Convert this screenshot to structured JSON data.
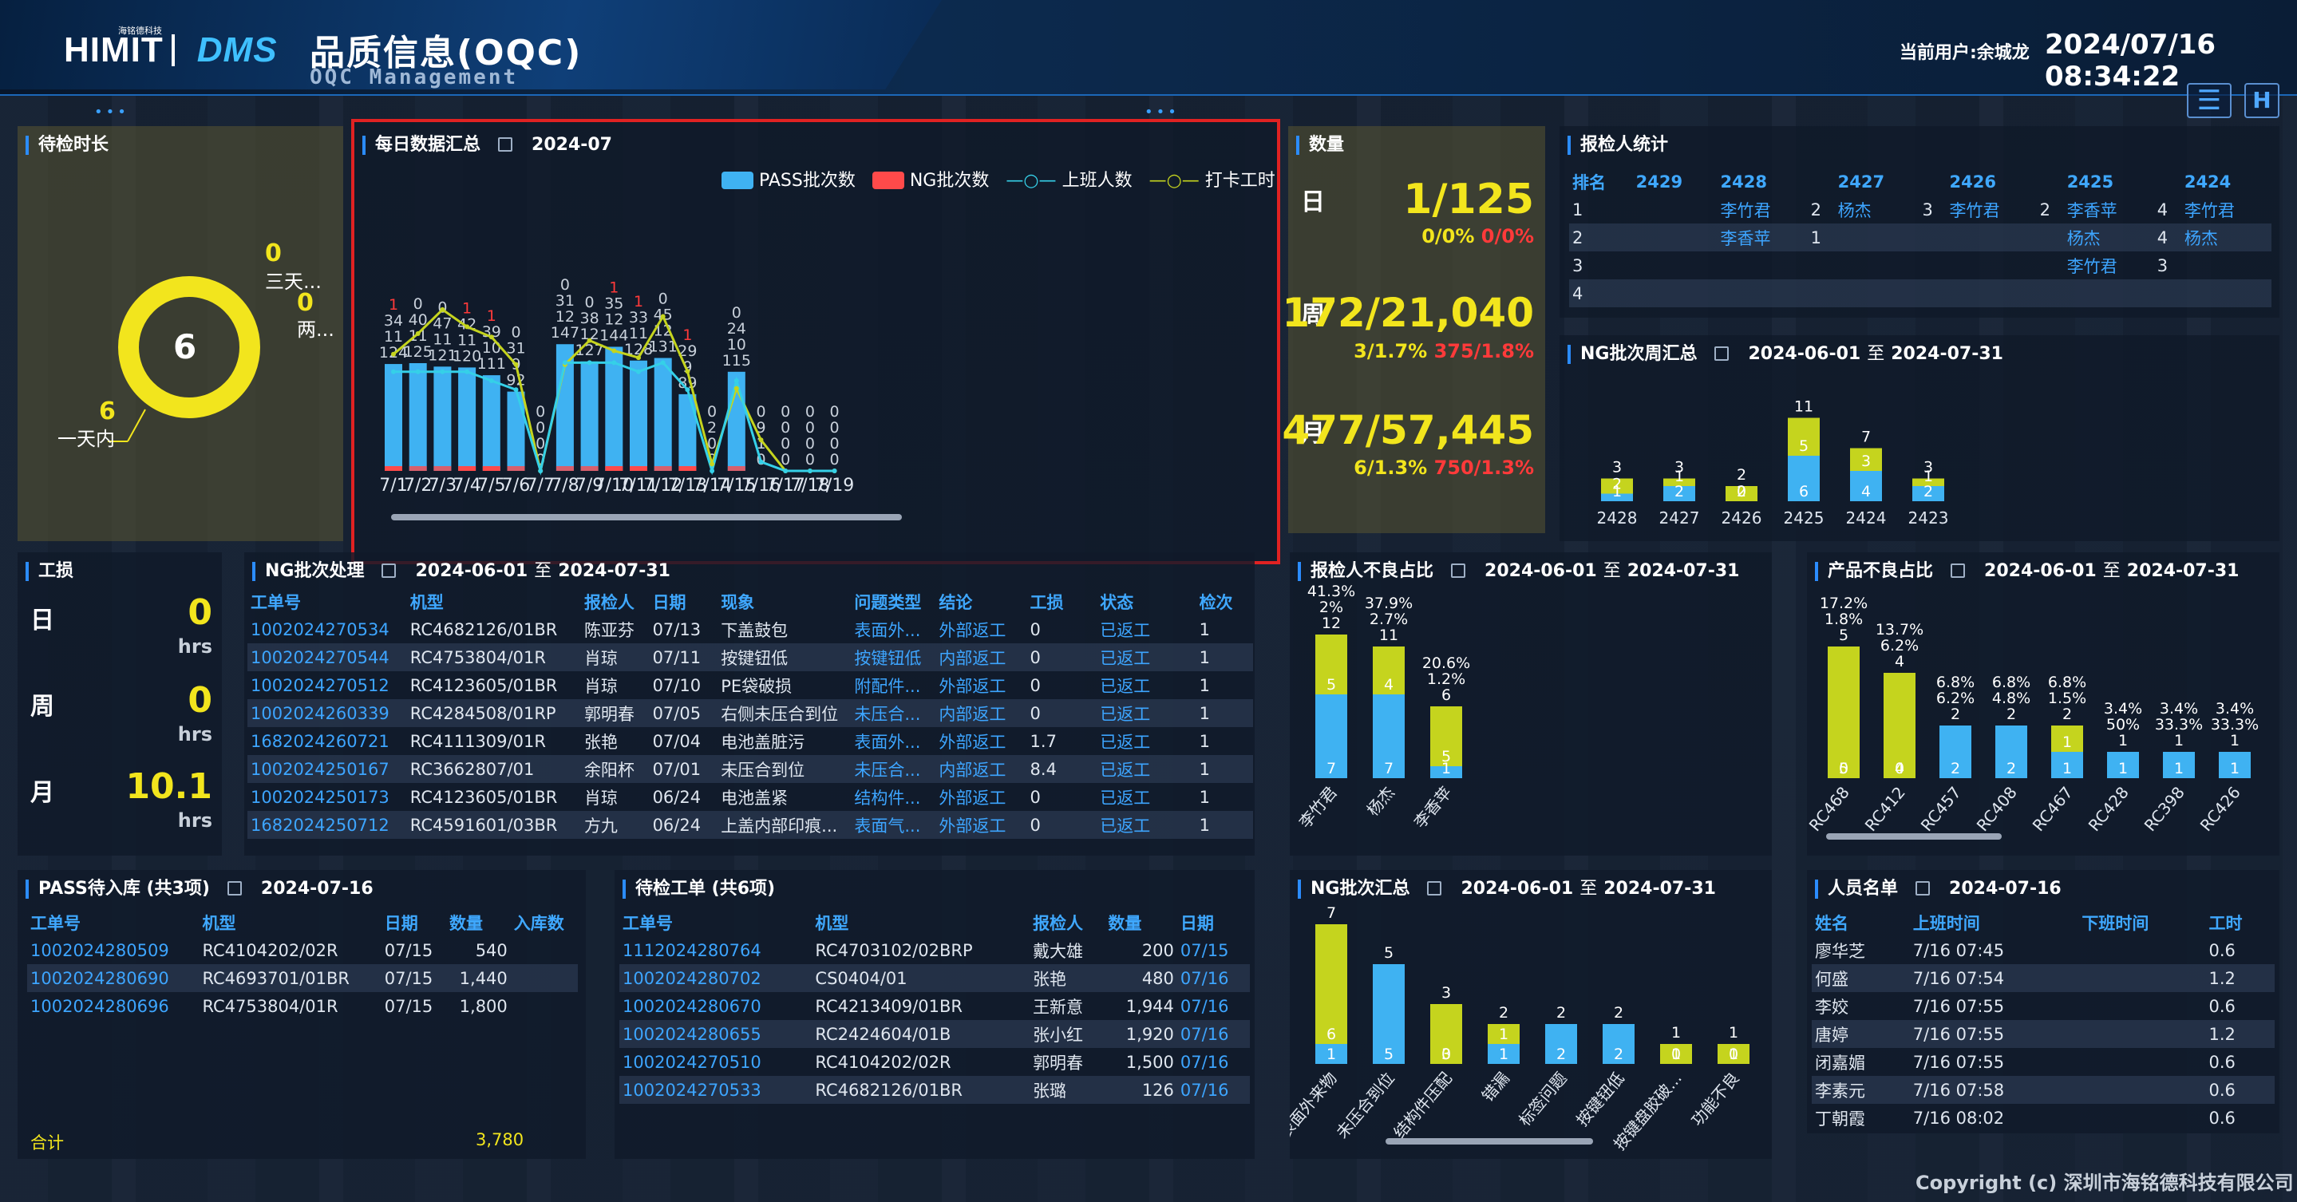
{
  "header": {
    "brand": "HIMIT",
    "brand_sub": "海铭德科技",
    "product": "DMS",
    "title": "品质信息(OQC)",
    "subtitle": "OQC Management",
    "user": "当前用户:余城龙",
    "datetime": "2024/07/16 08:34:22",
    "menu_icon": "list-collapse-icon",
    "home_icon": "H"
  },
  "waiting": {
    "title": "待检时长",
    "center": "6",
    "items": [
      {
        "count": "0",
        "label": "三天..."
      },
      {
        "count": "0",
        "label": "两..."
      },
      {
        "count": "6",
        "label": "一天内"
      }
    ],
    "ring_color": "#f2e51d"
  },
  "daily": {
    "title": "每日数据汇总",
    "date": "2024-07",
    "legend": [
      "PASS批次数",
      "NG批次数",
      "上班人数",
      "打卡工时"
    ],
    "chart_data": {
      "type": "bar",
      "categories": [
        "7/1",
        "7/2",
        "7/3",
        "7/4",
        "7/5",
        "7/6",
        "7/7",
        "7/8",
        "7/9",
        "7/10",
        "7/11",
        "7/12",
        "7/13",
        "7/14",
        "7/15",
        "7/16",
        "7/17",
        "7/18",
        "7/19"
      ],
      "series": [
        {
          "name": "PASS批次数",
          "values": [
            124,
            125,
            121,
            120,
            111,
            92,
            0,
            147,
            127,
            144,
            128,
            131,
            89,
            0,
            115,
            0,
            0,
            0,
            0
          ]
        },
        {
          "name": "NG批次数",
          "values": [
            1,
            0,
            0,
            1,
            1,
            0,
            0,
            0,
            0,
            1,
            1,
            0,
            1,
            0,
            0,
            0,
            0,
            0,
            0
          ]
        },
        {
          "name": "上班人数",
          "values": [
            11,
            11,
            11,
            11,
            10,
            9,
            0,
            12,
            12,
            12,
            11,
            12,
            9,
            0,
            10,
            1,
            0,
            0,
            0
          ]
        },
        {
          "name": "打卡工时",
          "values": [
            34,
            40,
            47,
            42,
            39,
            31,
            0,
            31,
            38,
            35,
            33,
            45,
            29,
            2,
            24,
            9,
            0,
            0,
            0
          ]
        }
      ],
      "top_labels": [
        "0",
        "0",
        "0",
        "0",
        "0",
        "0",
        "0",
        "0",
        "0",
        "0",
        "0",
        "0",
        "0",
        "0",
        "0",
        "0",
        "0",
        "0",
        "0"
      ],
      "colors": {
        "pass": "#3fb2f2",
        "ng": "#ff4a4a",
        "people": "#35d0e8",
        "hours": "#c5d41e"
      }
    }
  },
  "qty": {
    "title": "数量",
    "day_label": "日",
    "day": "1/125",
    "day_pct_a": "0/0%",
    "day_pct_b": "0/0%",
    "week_label": "周",
    "week": "172/21,040",
    "week_pct_a": "3/1.7%",
    "week_pct_b": "375/1.8%",
    "month_label": "月",
    "month": "477/57,445",
    "month_pct_a": "6/1.3%",
    "month_pct_b": "750/1.3%"
  },
  "inspector": {
    "title": "报检人统计",
    "headers": [
      "排名",
      "2429",
      "2428",
      "",
      "2427",
      "",
      "2426",
      "",
      "2425",
      "",
      "2424"
    ],
    "rows": [
      [
        "1",
        "",
        "李竹君",
        "2",
        "杨杰",
        "3",
        "李竹君",
        "2",
        "李香苹",
        "4",
        "李竹君"
      ],
      [
        "2",
        "",
        "李香苹",
        "1",
        "",
        "",
        "",
        "",
        "杨杰",
        "4",
        "杨杰"
      ],
      [
        "3",
        "",
        "",
        "",
        "",
        "",
        "",
        "",
        "李竹君",
        "3",
        ""
      ],
      [
        "4",
        "",
        "",
        "",
        "",
        "",
        "",
        "",
        "",
        "",
        ""
      ]
    ]
  },
  "ngweek": {
    "title": "NG批次周汇总",
    "from": "2024-06-01",
    "to": "2024-07-31",
    "zhi": "至",
    "chart_data": {
      "type": "bar",
      "categories": [
        "2428",
        "2427",
        "2426",
        "2425",
        "2424",
        "2423"
      ],
      "series": [
        {
          "name": "a",
          "values": [
            1,
            2,
            0,
            6,
            4,
            2
          ]
        },
        {
          "name": "b",
          "values": [
            2,
            1,
            2,
            5,
            3,
            1
          ]
        }
      ],
      "totals": [
        3,
        3,
        2,
        11,
        7,
        3
      ]
    }
  },
  "gongsun": {
    "title": "工损",
    "day_label": "日",
    "day": "0",
    "week_label": "周",
    "week": "0",
    "month_label": "月",
    "month": "10.1",
    "unit": "hrs"
  },
  "ngproc": {
    "title": "NG批次处理",
    "from": "2024-06-01",
    "to": "2024-07-31",
    "zhi": "至",
    "headers": [
      "工单号",
      "机型",
      "报检人",
      "日期",
      "现象",
      "问题类型",
      "结论",
      "工损",
      "状态",
      "检次"
    ],
    "rows": [
      [
        "1002024270534",
        "RC4682126/01BR",
        "陈亚芬",
        "07/13",
        "下盖鼓包",
        "表面外...",
        "外部返工",
        "0",
        "已返工",
        "1"
      ],
      [
        "1002024270544",
        "RC4753804/01R",
        "肖琼",
        "07/11",
        "按键钮低",
        "按键钮低",
        "内部返工",
        "0",
        "已返工",
        "1"
      ],
      [
        "1002024270512",
        "RC4123605/01BR",
        "肖琼",
        "07/10",
        "PE袋破损",
        "附配件...",
        "外部返工",
        "0",
        "已返工",
        "1"
      ],
      [
        "1002024260339",
        "RC4284508/01RP",
        "郭明春",
        "07/05",
        "右侧未压合到位",
        "未压合...",
        "内部返工",
        "0",
        "已返工",
        "1"
      ],
      [
        "1682024260721",
        "RC4111309/01R",
        "张艳",
        "07/04",
        "电池盖脏污",
        "表面外...",
        "外部返工",
        "1.7",
        "已返工",
        "1"
      ],
      [
        "1002024250167",
        "RC3662807/01",
        "余阳杯",
        "07/01",
        "未压合到位",
        "未压合...",
        "内部返工",
        "8.4",
        "已返工",
        "1"
      ],
      [
        "1002024250173",
        "RC4123605/01BR",
        "肖琼",
        "06/24",
        "电池盖紧",
        "结构件...",
        "外部返工",
        "0",
        "已返工",
        "1"
      ],
      [
        "1682024250712",
        "RC4591601/03BR",
        "方九",
        "06/24",
        "上盖内部印痕...",
        "表面气...",
        "外部返工",
        "0",
        "已返工",
        "1"
      ]
    ]
  },
  "reporterbad": {
    "title": "报检人不良占比",
    "from": "2024-06-01",
    "to": "2024-07-31",
    "zhi": "至",
    "chart_data": {
      "type": "bar",
      "categories": [
        "李竹君",
        "杨杰",
        "李香苹"
      ],
      "a": [
        7,
        7,
        1
      ],
      "b": [
        5,
        4,
        5
      ],
      "totals": [
        12,
        11,
        6
      ],
      "pct1": [
        "41.3%",
        "37.9%",
        "20.6%"
      ],
      "pct2": [
        "2%",
        "2.7%",
        "1.2%"
      ]
    }
  },
  "productbad": {
    "title": "产品不良占比",
    "from": "2024-06-01",
    "to": "2024-07-31",
    "zhi": "至",
    "chart_data": {
      "type": "bar",
      "categories": [
        "RC468",
        "RC412",
        "RC457",
        "RC408",
        "RC467",
        "RC428",
        "RC398",
        "RC426"
      ],
      "a": [
        0,
        0,
        2,
        2,
        1,
        1,
        1,
        1
      ],
      "b": [
        5,
        4,
        0,
        0,
        1,
        0,
        0,
        0
      ],
      "totals": [
        5,
        4,
        2,
        2,
        2,
        1,
        1,
        1
      ],
      "pct1": [
        "17.2%",
        "13.7%",
        "6.8%",
        "6.8%",
        "6.8%",
        "3.4%",
        "3.4%",
        "3.4%"
      ],
      "pct2": [
        "1.8%",
        "6.2%",
        "6.2%",
        "4.8%",
        "1.5%",
        "50%",
        "33.3%",
        "33.3%"
      ]
    }
  },
  "passstock": {
    "title": "PASS待入库 (共3项)",
    "date": "2024-07-16",
    "headers": [
      "工单号",
      "机型",
      "日期",
      "数量",
      "入库数"
    ],
    "rows": [
      [
        "1002024280509",
        "RC4104202/02R",
        "07/15",
        "540",
        ""
      ],
      [
        "1002024280690",
        "RC4693701/01BR",
        "07/15",
        "1,440",
        ""
      ],
      [
        "1002024280696",
        "RC4753804/01R",
        "07/15",
        "1,800",
        ""
      ]
    ],
    "sum_label": "合计",
    "sum": "3,780"
  },
  "pending": {
    "title": "待检工单 (共6项)",
    "headers": [
      "工单号",
      "机型",
      "报检人",
      "数量",
      "日期"
    ],
    "rows": [
      [
        "1112024280764",
        "RC4703102/02BRP",
        "戴大雄",
        "200",
        "07/15"
      ],
      [
        "1002024280702",
        "CS0404/01",
        "张艳",
        "480",
        "07/16"
      ],
      [
        "1002024280670",
        "RC4213409/01BR",
        "王新意",
        "1,944",
        "07/16"
      ],
      [
        "1002024280655",
        "RC2424604/01B",
        "张小红",
        "1,920",
        "07/16"
      ],
      [
        "1002024270510",
        "RC4104202/02R",
        "郭明春",
        "1,500",
        "07/16"
      ],
      [
        "1002024270533",
        "RC4682126/01BR",
        "张璐",
        "126",
        "07/16"
      ]
    ]
  },
  "ngsum": {
    "title": "NG批次汇总",
    "from": "2024-06-01",
    "to": "2024-07-31",
    "zhi": "至",
    "chart_data": {
      "type": "bar",
      "categories": [
        "表面外来物",
        "未压合到位",
        "结构件压配",
        "错漏",
        "标签问题",
        "按键钮低",
        "按键盘胶破...",
        "功能不良"
      ],
      "a": [
        1,
        5,
        0,
        1,
        2,
        2,
        0,
        0
      ],
      "b": [
        6,
        0,
        3,
        1,
        0,
        0,
        1,
        1
      ],
      "totals": [
        7,
        5,
        3,
        2,
        2,
        2,
        1,
        1
      ]
    }
  },
  "staff": {
    "title": "人员名单",
    "date": "2024-07-16",
    "headers": [
      "姓名",
      "上班时间",
      "下班时间",
      "工时"
    ],
    "rows": [
      [
        "廖华芝",
        "7/16 07:45",
        "",
        "0.6"
      ],
      [
        "何盛",
        "7/16 07:54",
        "",
        "1.2"
      ],
      [
        "李姣",
        "7/16 07:55",
        "",
        "0.6"
      ],
      [
        "唐婷",
        "7/16 07:55",
        "",
        "1.2"
      ],
      [
        "闭嘉媚",
        "7/16 07:55",
        "",
        "0.6"
      ],
      [
        "李素元",
        "7/16 07:58",
        "",
        "0.6"
      ],
      [
        "丁朝霞",
        "7/16 08:02",
        "",
        "0.6"
      ]
    ]
  },
  "footer": {
    "copyright": "Copyright (c) 深圳市海铭德科技有限公司"
  }
}
